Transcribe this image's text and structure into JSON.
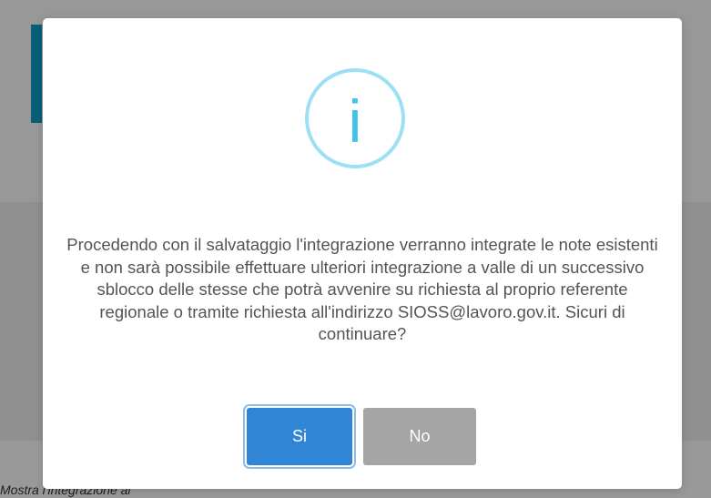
{
  "background": {
    "partial_text": "Mostra l'integrazione al"
  },
  "dialog": {
    "icon": "info-icon",
    "icon_color": "#3fc3ee",
    "icon_glyph": "i",
    "message": "Procedendo con il salvataggio l'integrazione verranno integrate le note esistenti e non sarà possibile effettuare ulteriori integrazione a valle di un successivo sblocco delle stesse che potrà avvenire su richiesta al proprio referente regionale o tramite richiesta all'indirizzo SIOSS@lavoro.gov.it. Sicuri di continuare?",
    "confirm_label": "Si",
    "confirm_color": "#3085d6",
    "cancel_label": "No",
    "cancel_color": "#a5a5a5"
  }
}
